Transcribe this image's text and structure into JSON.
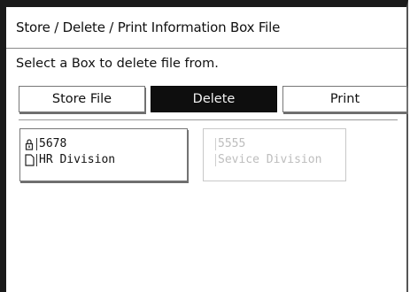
{
  "window": {
    "title": "Store / Delete / Print Information Box File"
  },
  "instruction": "Select a Box to delete file from.",
  "tabs": [
    {
      "label": "Store File",
      "selected": false
    },
    {
      "label": "Delete",
      "selected": true
    },
    {
      "label": "Print",
      "selected": false
    }
  ],
  "boxes": [
    {
      "number": "5678",
      "name": "HR Division",
      "enabled": true,
      "icons": [
        "lock-icon",
        "document-icon"
      ]
    },
    {
      "number": "5555",
      "name": "Sevice Division",
      "enabled": false
    }
  ],
  "colors": {
    "selected_bg": "#0e0e0e",
    "disabled_text": "#bdbdbd"
  }
}
